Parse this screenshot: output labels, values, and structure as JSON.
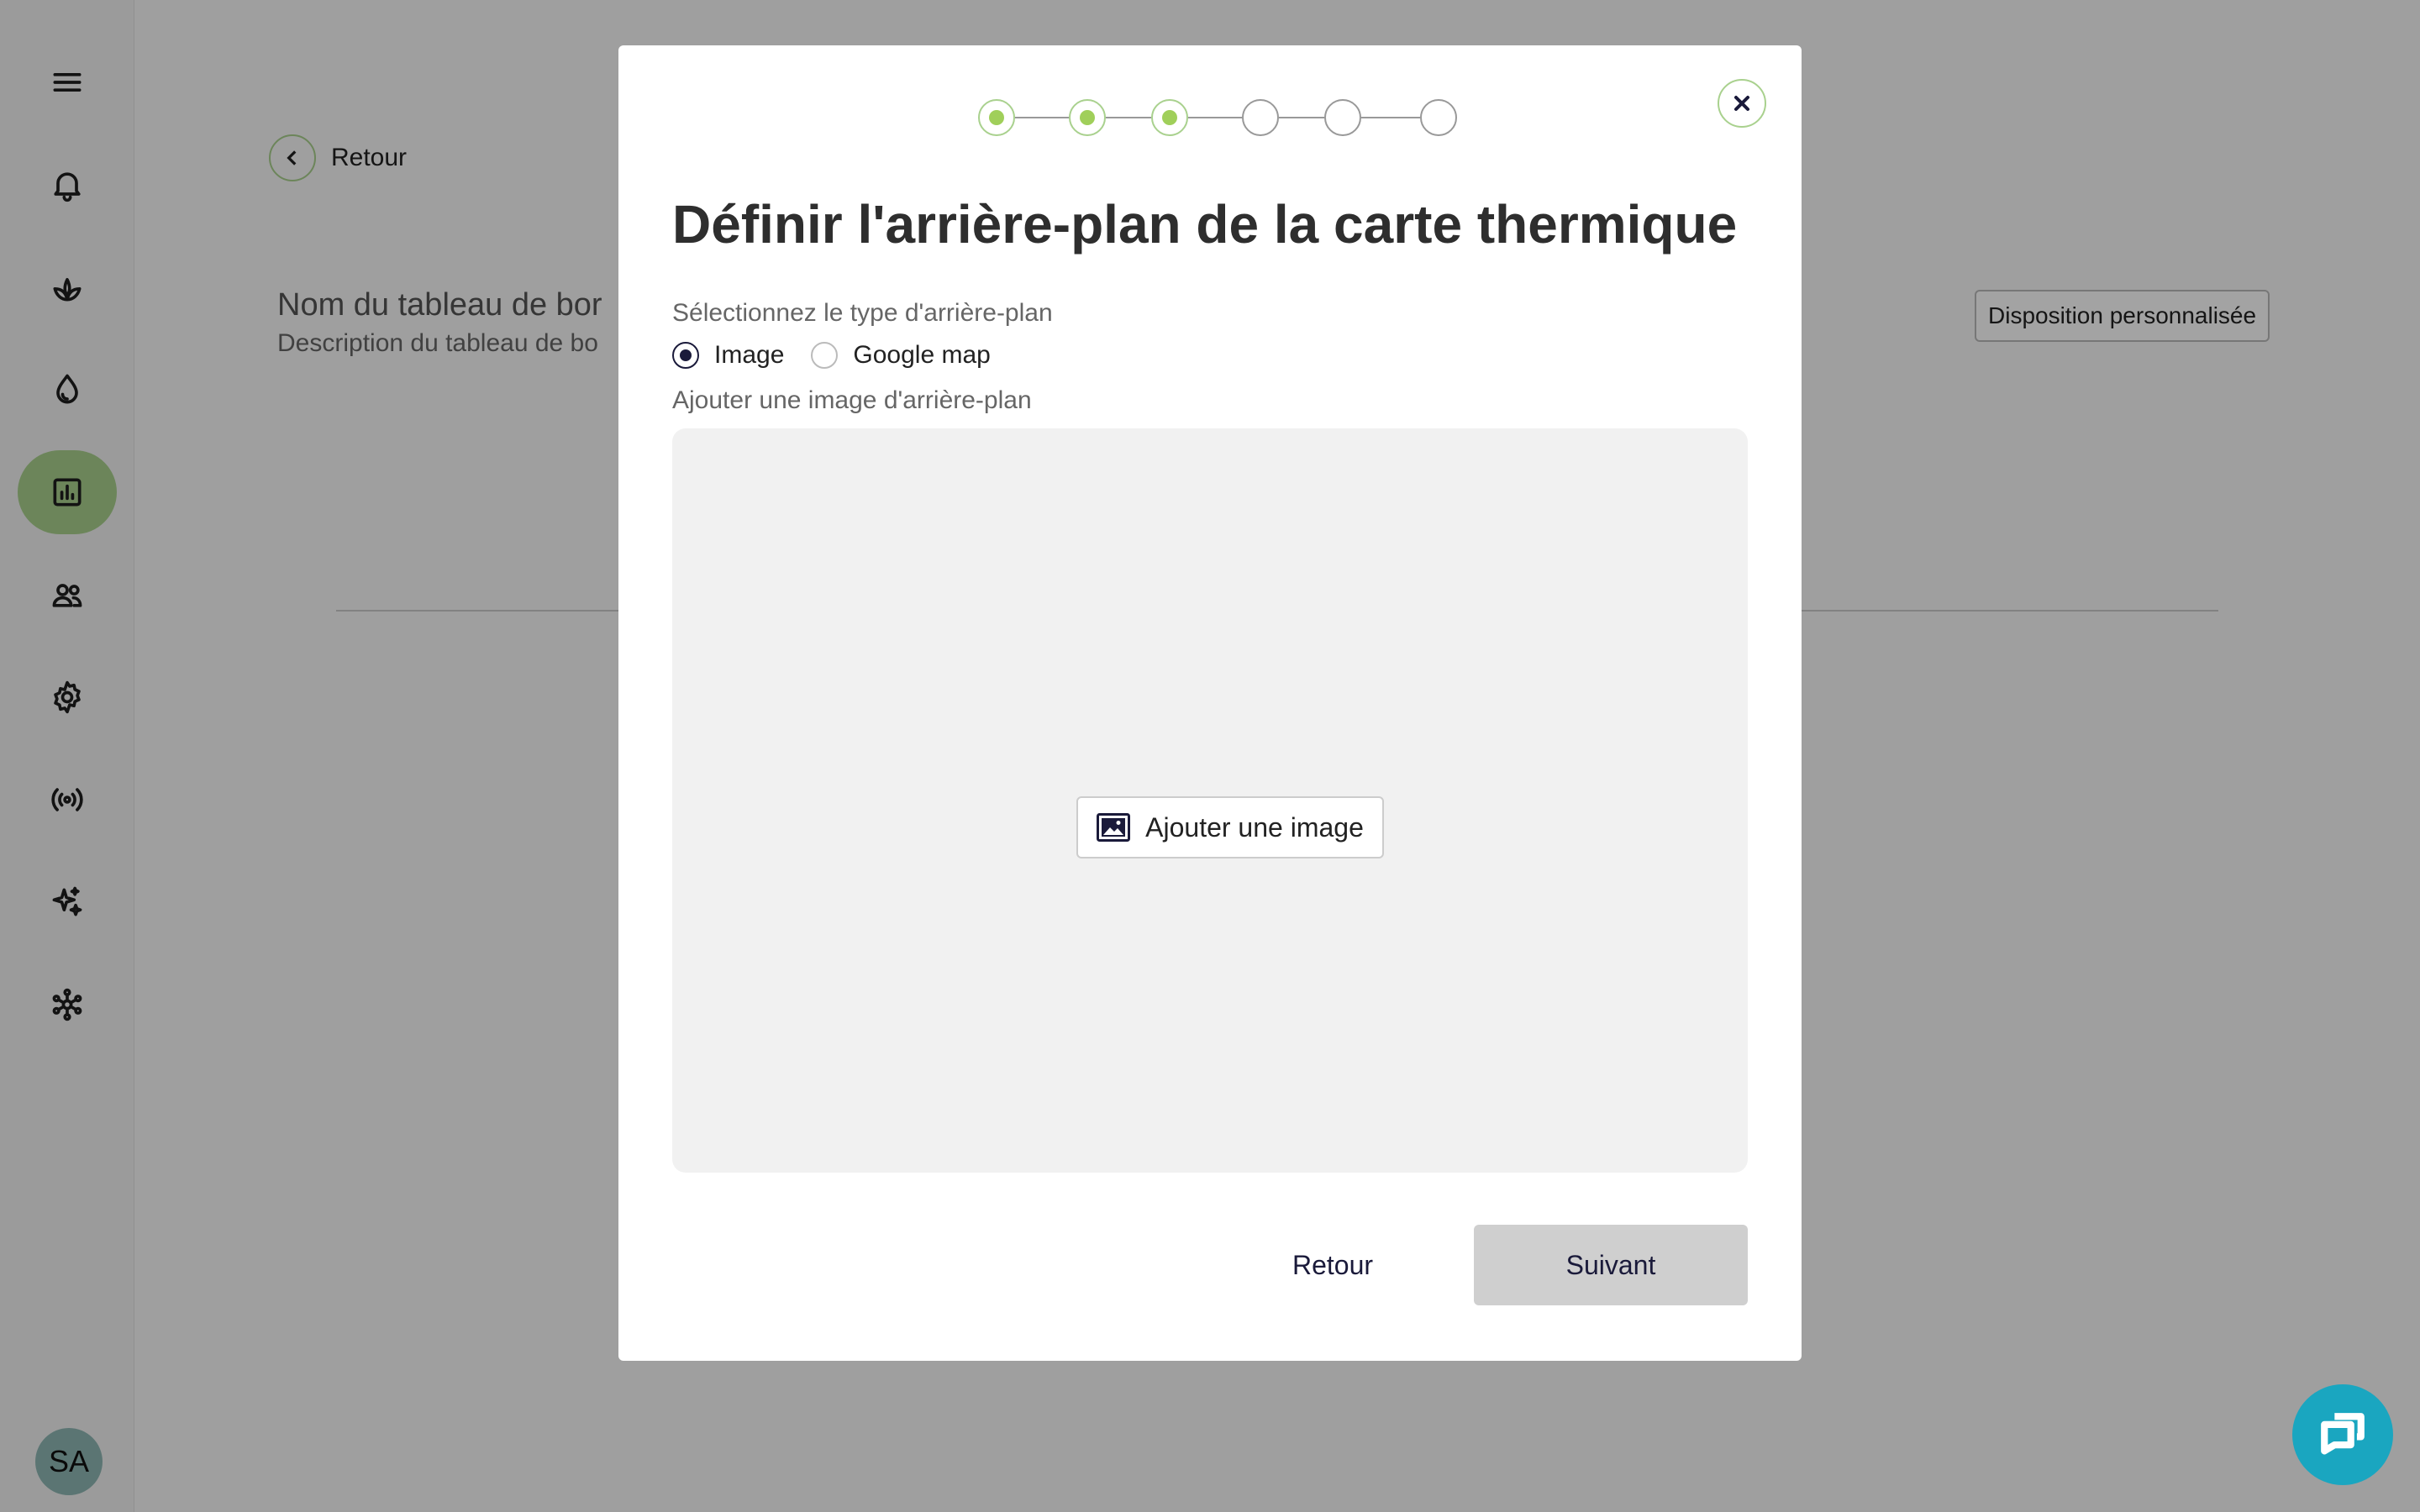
{
  "sidebar": {
    "items": [
      {
        "icon": "menu-icon"
      },
      {
        "icon": "bell-icon"
      },
      {
        "icon": "plant-icon"
      },
      {
        "icon": "water-drop-icon"
      },
      {
        "icon": "bar-chart-icon",
        "active": true
      },
      {
        "icon": "users-icon"
      },
      {
        "icon": "gear-icon"
      },
      {
        "icon": "broadcast-icon"
      },
      {
        "icon": "sparkles-icon"
      },
      {
        "icon": "network-icon"
      }
    ],
    "avatar_initials": "SA"
  },
  "page": {
    "back_label": "Retour",
    "dashboard_name": "Nom du tableau de bor",
    "dashboard_description": "Description du tableau de bo",
    "layout_button": "Disposition personnalisée"
  },
  "modal": {
    "steps": [
      {
        "state": "done"
      },
      {
        "state": "done"
      },
      {
        "state": "done"
      },
      {
        "state": "pending"
      },
      {
        "state": "pending"
      },
      {
        "state": "pending"
      }
    ],
    "title": "Définir l'arrière-plan de la carte thermique",
    "background_type_label": "Sélectionnez le type d'arrière-plan",
    "radio_image": "Image",
    "radio_google_map": "Google map",
    "selected_type": "Image",
    "add_background_label": "Ajouter une image d'arrière-plan",
    "add_image_button": "Ajouter une image",
    "back_button": "Retour",
    "next_button": "Suivant"
  },
  "colors": {
    "accent_green": "#a9d18e",
    "step_done": "#a0cf5a",
    "chat_fab": "#1aa6c0",
    "primary_dark": "#1a1a3a"
  }
}
